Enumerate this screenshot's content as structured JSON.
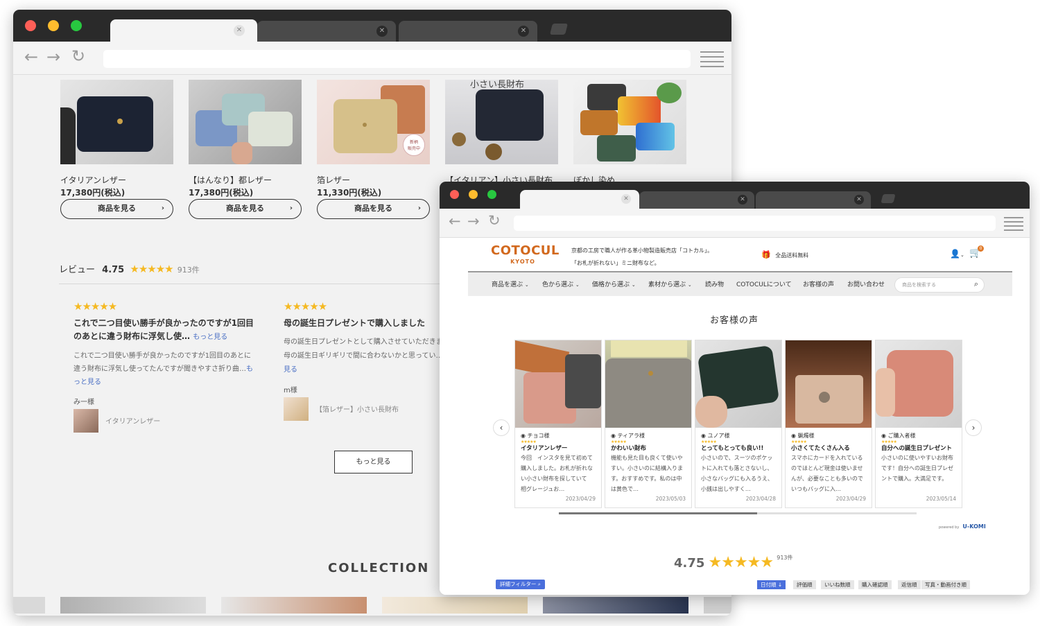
{
  "back_window": {
    "products": [
      {
        "name": "イタリアンレザー",
        "price": "17,380円(税込)",
        "button": "商品を見る"
      },
      {
        "name": "【はんなり】都レザー",
        "price": "17,380円(税込)",
        "button": "商品を見る"
      },
      {
        "name": "箔レザー",
        "price": "11,330円(税込)",
        "button": "商品を見る"
      },
      {
        "name": "【イタリアン】小さい長財布",
        "price": "",
        "button": ""
      },
      {
        "name": "ぼかし染め",
        "price": "",
        "button": ""
      }
    ],
    "product3_badge": "新柄\n販売中",
    "product4_overlay": "小さい長財布",
    "review_heading": "レビュー",
    "review_score": "4.75",
    "review_count": "913件",
    "reviews": [
      {
        "title": "これで二つ目使い勝手が良かったのですが1回目のあとに違う財布に浮気し使…",
        "title_more": "もっと見る",
        "body": "これで二つ目使い勝手が良かったのですが1回目のあとに違う財布に浮気し使ってたんですが聞きやすさ折り曲…",
        "body_more": "もっと見る",
        "author": "み一様",
        "product": "イタリアンレザー"
      },
      {
        "title": "母の誕生日プレゼントで購入しました",
        "title_more": "",
        "body": "母の誕生日プレゼントとして購入させていただきました。母の誕生日ギリギリで間に合わないかと思ってい…",
        "body_more": "もっと見る",
        "author": "m様",
        "product": "【箔レザー】小さい長財布"
      }
    ],
    "more_button": "もっと見る",
    "collection_heading": "COLLECTION"
  },
  "front_window": {
    "logo": "COTOCUL",
    "logo_sub": "KYOTO",
    "tagline_1": "京都の工房で職人が作る革小物製造販売店「コトカル」。",
    "tagline_2": "「お札が折れない」ミニ財布など。",
    "shipping": "全品送料無料",
    "cart_count": "0",
    "nav": [
      "商品を選ぶ",
      "色から選ぶ",
      "価格から選ぶ",
      "素材から選ぶ",
      "読み物",
      "COTOCULについて",
      "お客様の声",
      "お問い合わせ"
    ],
    "search_placeholder": "商品を検索する",
    "voices_heading": "お客様の声",
    "cards": [
      {
        "name": "チョコ様",
        "title": "イタリアンレザー",
        "body": "今回　インスタを見て初めて購入しました。お札が折れない小さい財布を探していて　相グレージュお…",
        "date": "2023/04/29"
      },
      {
        "name": "ティアラ様",
        "title": "かわいい財布",
        "body": "機能も見た目も良くて使いやすい。小さいのに結構入ります。おすすめです。私のは中は黄色で…",
        "date": "2023/05/03"
      },
      {
        "name": "ユノア様",
        "title": "とってもとっても良い!!",
        "body": "小さいので、スーツのポケットに入れても落とさないし、小さなバッグにも入るうえ、小銭は出しやすく…",
        "date": "2023/04/28"
      },
      {
        "name": "蝋燭様",
        "title": "小さくてたくさん入る",
        "body": "スマホにカードを入れているのでほとんど現金は使いませんが、必要なことも多いのでいつもバッグに入…",
        "date": "2023/04/29"
      },
      {
        "name": "ご購入者様",
        "title": "自分への誕生日プレゼント",
        "body": "小さいのに使いやすいお財布です！自分への誕生日プレゼントで購入。大満足です。",
        "date": "2023/05/14"
      }
    ],
    "powered_by": "powered by",
    "powered_brand": "U-KOMI",
    "score": "4.75",
    "count": "913件",
    "filter_button": "詳細フィルター",
    "sort_buttons": [
      "日付順 ↓",
      "評価順",
      "いいね数順",
      "購入確認順",
      "返信順",
      "写真・動画付き順"
    ]
  },
  "colors": {
    "star": "#f5b922",
    "logo": "#d2691e",
    "link": "#4a6fc4",
    "accent_blue": "#4a6fdc"
  }
}
